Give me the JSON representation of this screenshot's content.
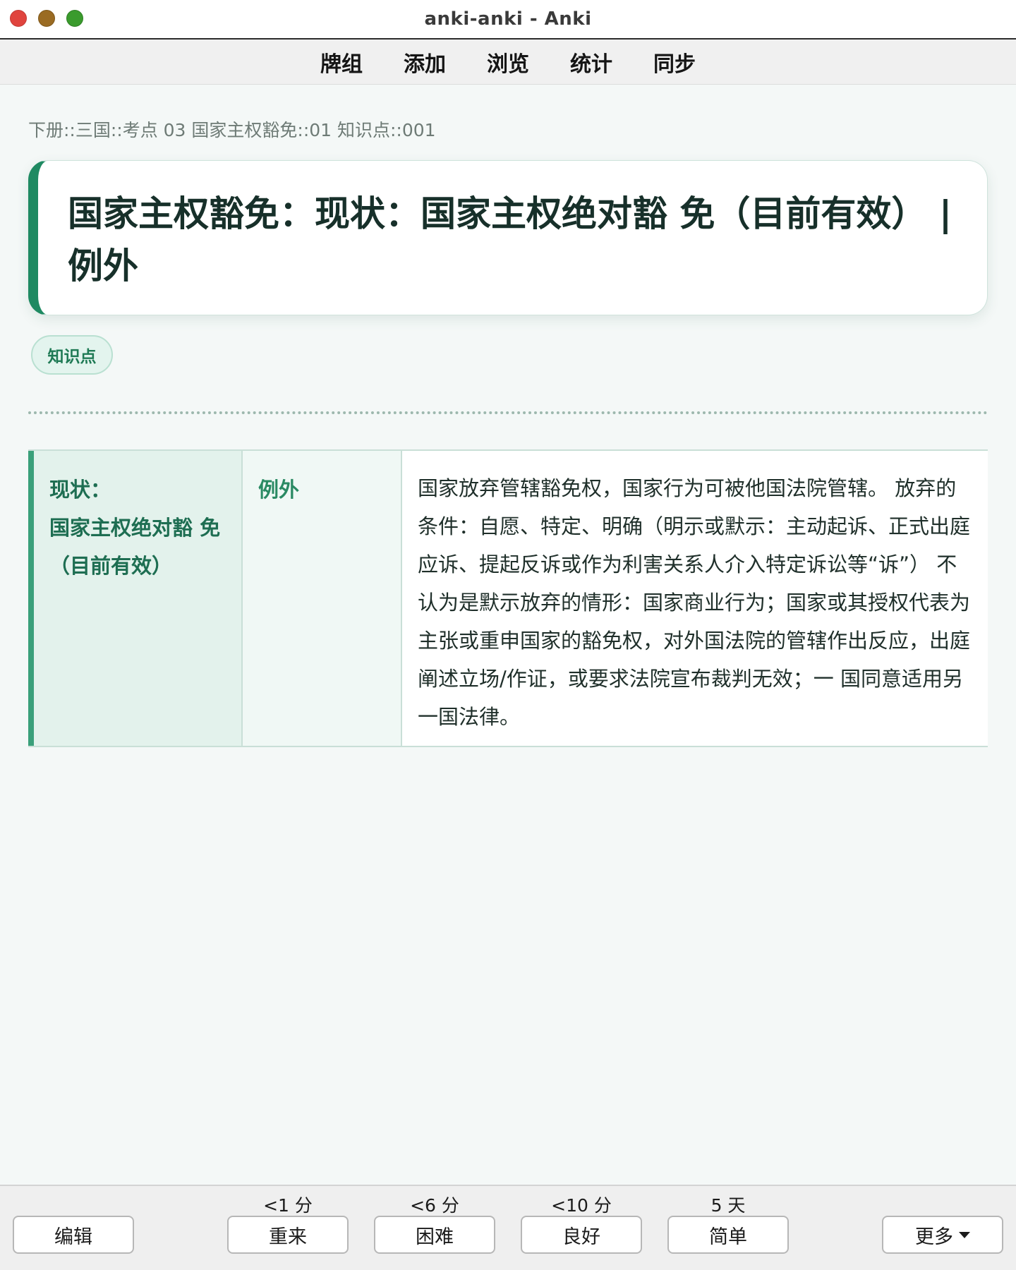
{
  "window": {
    "title": "anki-anki - Anki"
  },
  "nav": {
    "items": [
      {
        "label": "牌组"
      },
      {
        "label": "添加"
      },
      {
        "label": "浏览"
      },
      {
        "label": "统计"
      },
      {
        "label": "同步"
      }
    ]
  },
  "card": {
    "breadcrumb": "下册::三国::考点 03 国家主权豁免::01 知识点::001",
    "title": "国家主权豁免：现状：国家主权绝对豁 免（目前有效） | 例外",
    "tag": "知识点",
    "table": {
      "col_a_lines": [
        "现状：",
        "国家主权绝对豁 免",
        "（目前有效）"
      ],
      "col_b": "例外",
      "col_c": "国家放弃管辖豁免权，国家行为可被他国法院管辖。 放弃的条件：自愿、特定、明确（明示或默示：主动起诉、正式出庭应诉、提起反诉或作为利害关系人介入特定诉讼等“诉”） 不认为是默示放弃的情形：国家商业行为；国家或其授权代表为主张或重申国家的豁免权，对外国法院的管辖作出反应，出庭阐述立场/作证，或要求法院宣布裁判无效；一 国同意适用另一国法律。"
    }
  },
  "bottom": {
    "edit_label": "编辑",
    "more_label": "更多",
    "answers": [
      {
        "interval": "<1 分",
        "label": "重来"
      },
      {
        "interval": "<6 分",
        "label": "困难"
      },
      {
        "interval": "<10 分",
        "label": "良好"
      },
      {
        "interval": "5 天",
        "label": "简单"
      }
    ]
  },
  "colors": {
    "accent": "#1f8a62",
    "tag_bg": "#e3f4ee",
    "background": "#f4f8f7"
  }
}
